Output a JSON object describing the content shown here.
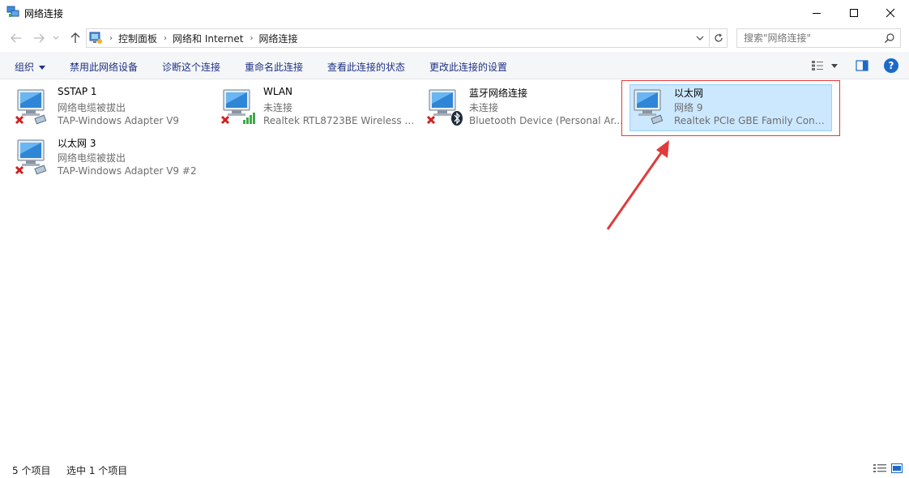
{
  "window": {
    "title": "网络连接",
    "controls": {
      "minimize": "minimize-icon",
      "maximize": "maximize-icon",
      "close": "close-icon"
    }
  },
  "nav": {
    "breadcrumb": [
      "控制面板",
      "网络和 Internet",
      "网络连接"
    ],
    "search_placeholder": "搜索\"网络连接\""
  },
  "toolbar": {
    "organize": "组织",
    "disable": "禁用此网络设备",
    "diagnose": "诊断这个连接",
    "rename": "重命名此连接",
    "view_status": "查看此连接的状态",
    "change_settings": "更改此连接的设置"
  },
  "connections": [
    {
      "name": "SSTAP 1",
      "status": "网络电缆被拔出",
      "device": "TAP-Windows Adapter V9",
      "state": "disconnected",
      "kind": "ethernet",
      "selected": false
    },
    {
      "name": "WLAN",
      "status": "未连接",
      "device": "Realtek RTL8723BE Wireless L...",
      "state": "disconnected",
      "kind": "wifi",
      "selected": false
    },
    {
      "name": "蓝牙网络连接",
      "status": "未连接",
      "device": "Bluetooth Device (Personal Ar...",
      "state": "disconnected",
      "kind": "bluetooth",
      "selected": false
    },
    {
      "name": "以太网",
      "status": "网络  9",
      "device": "Realtek PCIe GBE Family Contr...",
      "state": "connected",
      "kind": "ethernet",
      "selected": true
    },
    {
      "name": "以太网 3",
      "status": "网络电缆被拔出",
      "device": "TAP-Windows Adapter V9 #2",
      "state": "disconnected",
      "kind": "ethernet",
      "selected": false
    }
  ],
  "statusbar": {
    "count": "5 个项目",
    "selected": "选中 1 个项目"
  },
  "colors": {
    "accent": "#1e3287",
    "selection": "#cce8ff",
    "annotation": "#e23a3a",
    "disconnected": "#d61f1f"
  }
}
